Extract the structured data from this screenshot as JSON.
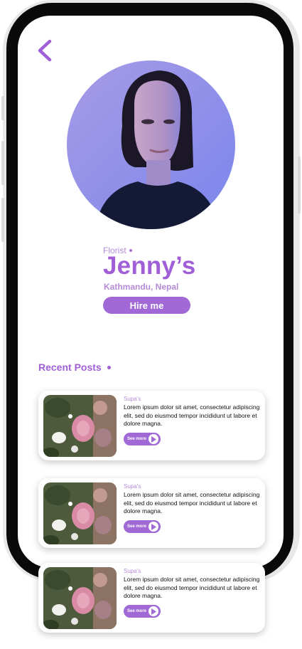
{
  "profile": {
    "role": "Florist",
    "name": "Jenny’s",
    "location": "Kathmandu, Nepal",
    "hire_label": "Hire me"
  },
  "recent_posts": {
    "title": "Recent Posts",
    "see_more_label": "See more",
    "items": [
      {
        "author": "Supa's",
        "text": "Lorem ipsum dolor sit amet, consectetur adipiscing elit, sed do eiusmod tempor incididunt ut labore et dolore magna."
      },
      {
        "author": "Supa's",
        "text": "Lorem ipsum dolor sit amet, consectetur adipiscing elit, sed do eiusmod tempor incididunt ut labore et dolore magna."
      },
      {
        "author": "Supa's",
        "text": "Lorem ipsum dolor sit amet, consectetur adipiscing elit, sed do eiusmod tempor incididunt ut labore et dolore magna."
      }
    ]
  },
  "colors": {
    "accent": "#a05fd7",
    "accent_light": "#b58ad8",
    "button": "#a069d6"
  },
  "icons": {
    "back": "chevron-left-icon",
    "play": "play-icon"
  }
}
